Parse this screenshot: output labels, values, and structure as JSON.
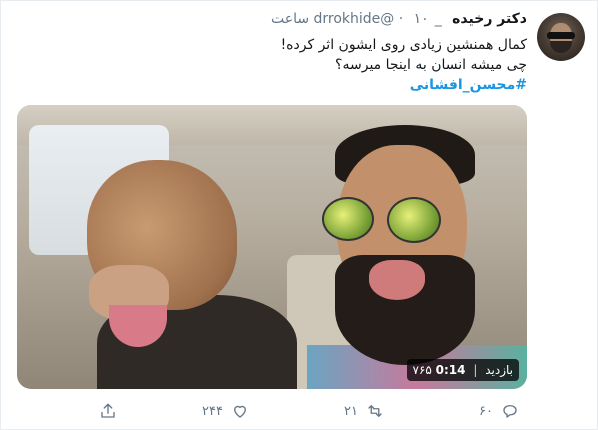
{
  "tweet": {
    "author": {
      "display_name": "دکتر رخیده",
      "handle": "_drrokhide@",
      "time": "۱۰ ساعت"
    },
    "text_lines": [
      "کمال همنشین زیادی روی ایشون اثر کرده!",
      "چی میشه انسان به اینجا میرسه؟"
    ],
    "hashtag": "#محسن_افشانی",
    "media": {
      "type": "video",
      "duration": "0:14",
      "views": "۷۶۵ بازدید"
    },
    "actions": {
      "reply_count": "۶۰",
      "retweet_count": "۲۱",
      "like_count": "۲۴۴",
      "share_count": ""
    },
    "icons": [
      "reply-icon",
      "retweet-icon",
      "like-icon",
      "share-icon"
    ],
    "colors": {
      "hashtag": "#1b95e0",
      "meta_text": "#657786",
      "body_text": "#14171a"
    }
  }
}
